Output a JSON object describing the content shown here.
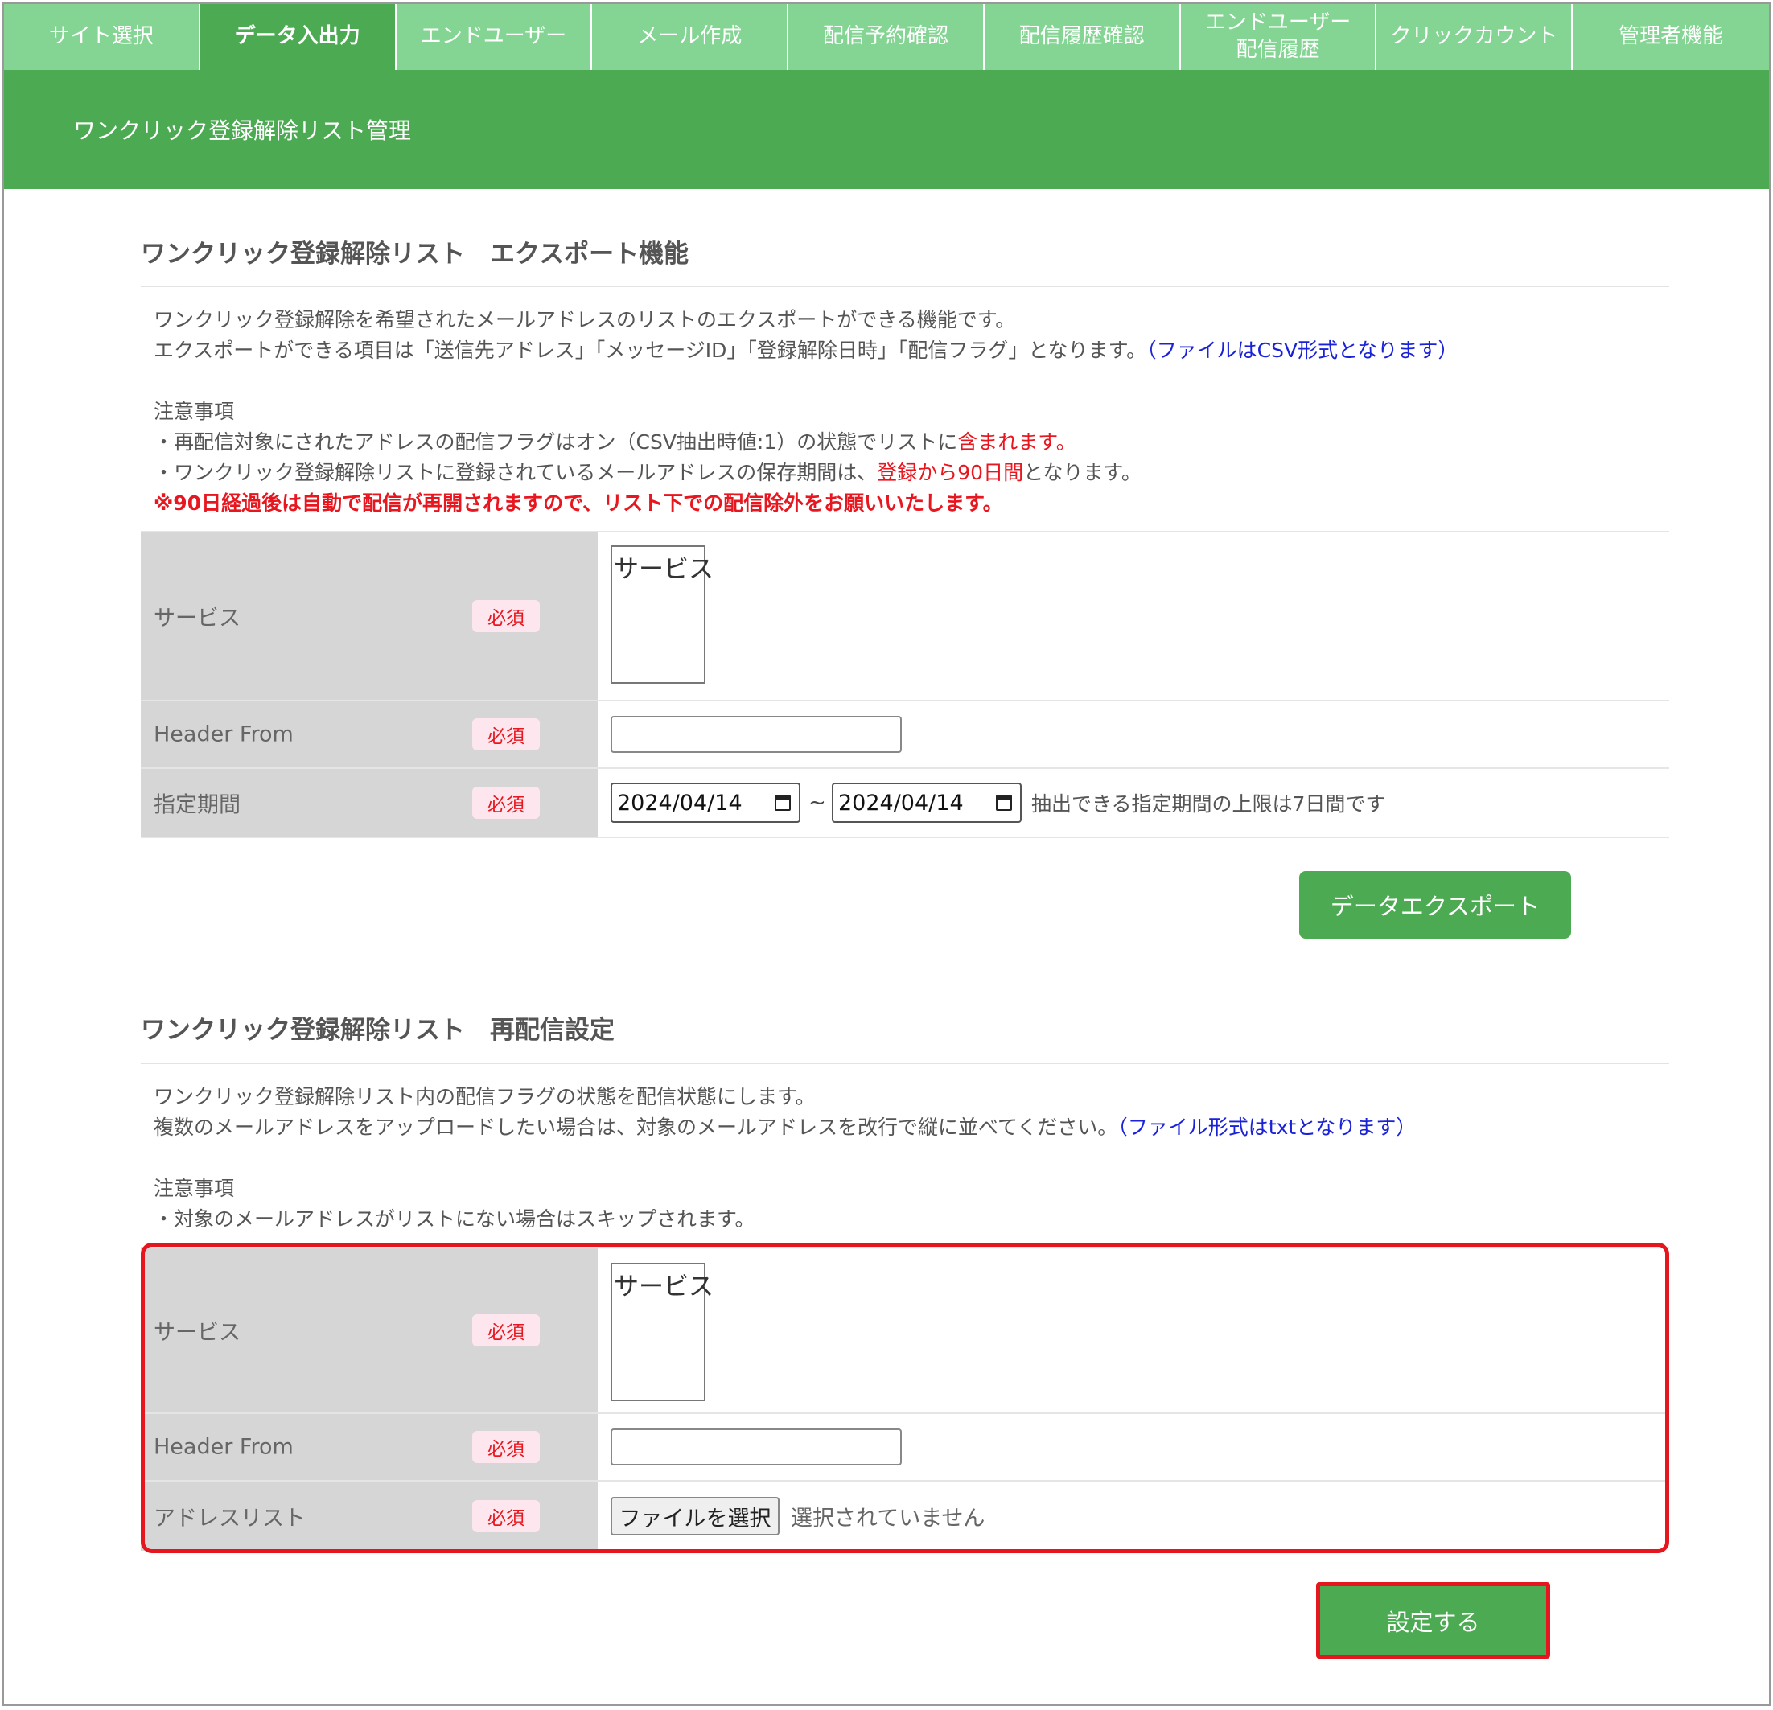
{
  "nav": {
    "tabs": [
      {
        "label": "サイト選択",
        "active": false
      },
      {
        "label": "データ入出力",
        "active": true
      },
      {
        "label": "エンドユーザー",
        "active": false
      },
      {
        "label": "メール作成",
        "active": false
      },
      {
        "label": "配信予約確認",
        "active": false
      },
      {
        "label": "配信履歴確認",
        "active": false
      },
      {
        "label": "エンドユーザー\n配信履歴",
        "active": false
      },
      {
        "label": "クリックカウント",
        "active": false
      },
      {
        "label": "管理者機能",
        "active": false
      }
    ]
  },
  "banner": {
    "title": "ワンクリック登録解除リスト管理"
  },
  "export_section": {
    "title": "ワンクリック登録解除リスト　エクスポート機能",
    "desc1": "ワンクリック登録解除を希望されたメールアドレスのリストのエクスポートができる機能です。",
    "desc2": "エクスポートができる項目は「送信先アドレス」「メッセージID」「登録解除日時」「配信フラグ」となります。",
    "desc2_note": "（ファイルはCSV形式となります）",
    "notes_heading": "注意事項",
    "note1_prefix": "・再配信対象にされたアドレスの配信フラグはオン（CSV抽出時値:1）の状態でリストに",
    "note1_highlight": "含まれます。",
    "note2_prefix": "・ワンクリック登録解除リストに登録されているメールアドレスの保存期間は、",
    "note2_highlight": "登録から90日間",
    "note2_suffix": "となります。",
    "warning": "※90日経過後は自動で配信が再開されますので、リスト下での配信除外をお願いいたします。",
    "fields": {
      "service_label": "サービス",
      "service_option": "サービス",
      "header_from_label": "Header From",
      "header_from_value": "",
      "period_label": "指定期間",
      "date_start": "2024/04/14",
      "date_end": "2024/04/14",
      "tilde": "~",
      "period_hint": "抽出できる指定期間の上限は7日間です"
    },
    "required_badge": "必須",
    "export_button": "データエクスポート"
  },
  "resend_section": {
    "title": "ワンクリック登録解除リスト　再配信設定",
    "desc1": "ワンクリック登録解除リスト内の配信フラグの状態を配信状態にします。",
    "desc2": "複数のメールアドレスをアップロードしたい場合は、対象のメールアドレスを改行で縦に並べてください。",
    "desc2_note": "（ファイル形式はtxtとなります）",
    "notes_heading": "注意事項",
    "note1": "・対象のメールアドレスがリストにない場合はスキップされます。",
    "fields": {
      "service_label": "サービス",
      "service_option": "サービス",
      "header_from_label": "Header From",
      "header_from_value": "",
      "address_list_label": "アドレスリスト",
      "file_button": "ファイルを選択",
      "file_status": "選択されていません"
    },
    "required_badge": "必須",
    "submit_button": "設定する"
  },
  "colors": {
    "brand_green": "#4caa52",
    "tab_green": "#84d493",
    "link_blue": "#1a22d8",
    "alert_red": "#e8161e",
    "highlight_red": "#e5161e"
  }
}
